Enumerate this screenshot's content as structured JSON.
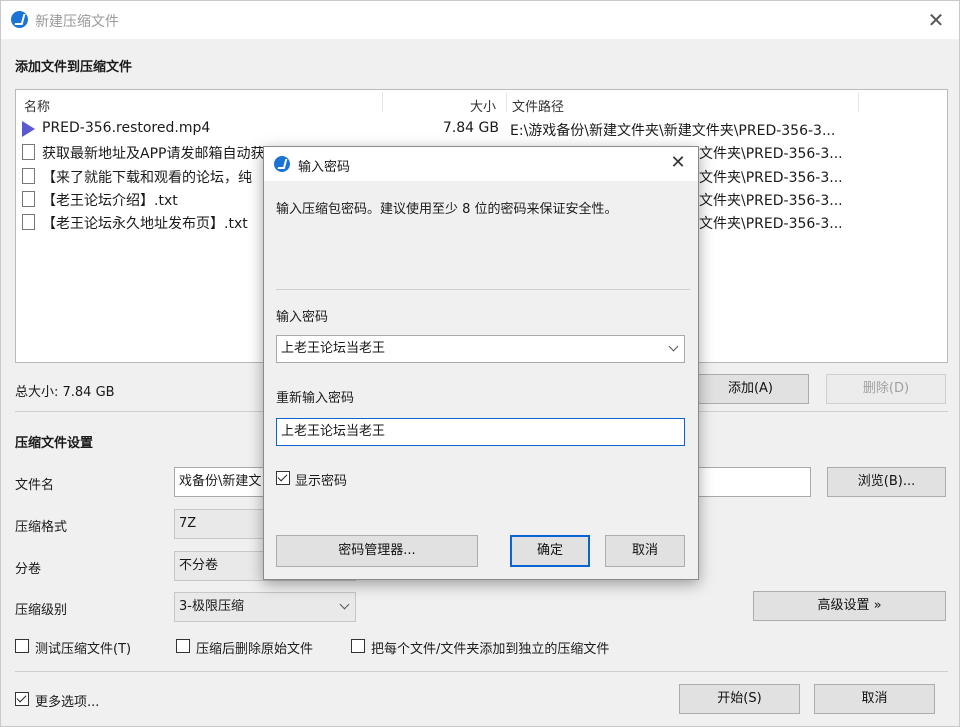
{
  "window": {
    "title": "新建压缩文件",
    "close_glyph": "✕"
  },
  "add_section": {
    "title": "添加文件到压缩文件"
  },
  "file_list": {
    "columns": {
      "name": "名称",
      "size": "大小",
      "path": "文件路径"
    },
    "rows": [
      {
        "name": "PRED-356.restored.mp4",
        "size": "7.84 GB",
        "path": "E:\\游戏备份\\新建文件夹\\新建文件夹\\PRED-356-3...",
        "icon": "video-file-icon"
      },
      {
        "name": "获取最新地址及APP请发邮箱自动获取",
        "size": "",
        "path": "文件夹\\PRED-356-3...",
        "icon": "text-file-icon"
      },
      {
        "name": "【来了就能下载和观看的论坛，纯",
        "size": "",
        "path": "文件夹\\PRED-356-3...",
        "icon": "text-file-icon"
      },
      {
        "name": "【老王论坛介绍】.txt",
        "size": "",
        "path": "文件夹\\PRED-356-3...",
        "icon": "text-file-icon"
      },
      {
        "name": "【老王论坛永久地址发布页】.txt",
        "size": "",
        "path": "文件夹\\PRED-356-3...",
        "icon": "text-file-icon"
      }
    ]
  },
  "total_size": "总大小: 7.84 GB",
  "buttons": {
    "add": "添加(A)",
    "delete": "删除(D)",
    "browse": "浏览(B)...",
    "advanced": "高级设置 »",
    "start": "开始(S)",
    "cancel": "取消"
  },
  "settings": {
    "title": "压缩文件设置",
    "filename_label": "文件名",
    "filename_value": "戏备份\\新建文",
    "format_label": "压缩格式",
    "format_value": "7Z",
    "split_label": "分卷",
    "split_value": "不分卷",
    "level_label": "压缩级别",
    "level_value": "3-极限压缩"
  },
  "options": {
    "test": "测试压缩文件(T)",
    "delete_after": "压缩后删除原始文件",
    "each_separate": "把每个文件/文件夹添加到独立的压缩文件",
    "more": "更多选项..."
  },
  "dialog": {
    "title": "输入密码",
    "description": "输入压缩包密码。建议使用至少 8 位的密码来保证安全性。",
    "password_label": "输入密码",
    "password_value": "上老王论坛当老王",
    "confirm_label": "重新输入密码",
    "confirm_value": "上老王论坛当老王",
    "show_password": "显示密码",
    "manager_button": "密码管理器...",
    "ok_button": "确定",
    "cancel_button": "取消"
  },
  "colors": {
    "accent": "#0a64d2",
    "app_icon": "#1b73d6"
  }
}
